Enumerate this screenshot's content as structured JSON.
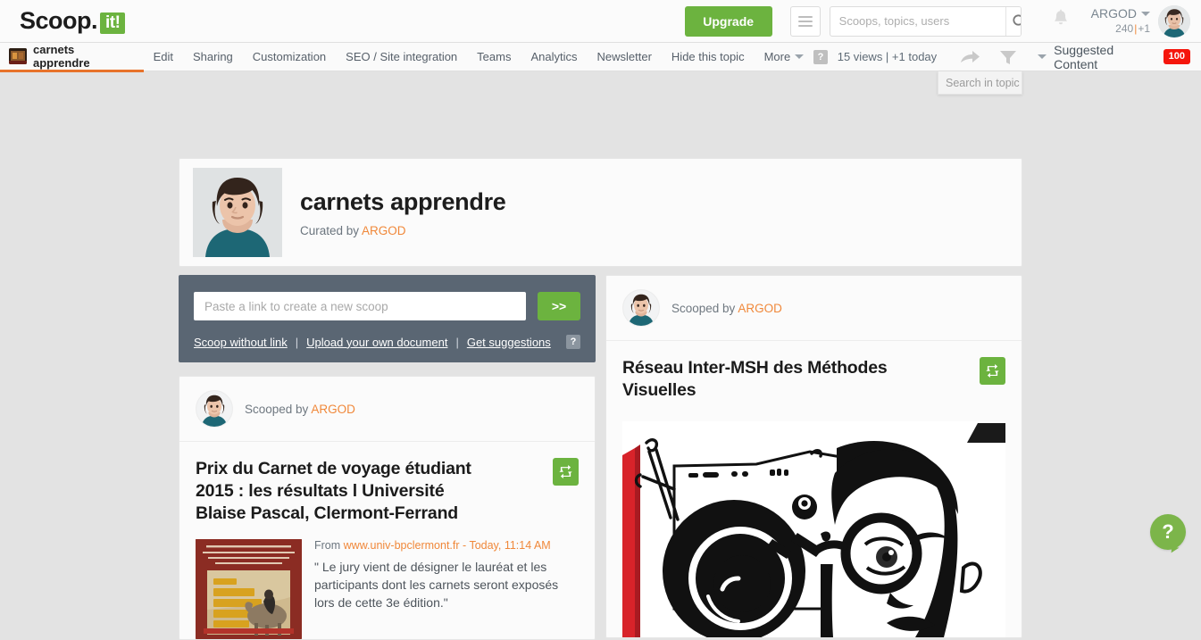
{
  "brand": {
    "name": "Scoop.",
    "suffix": "it!"
  },
  "topbar": {
    "upgrade_label": "Upgrade",
    "menu_icon": "hamburger-icon",
    "search_placeholder": "Scoops, topics, users",
    "search_value": "",
    "search_icon": "search-icon",
    "bell_icon": "bell-icon",
    "user_name": "ARGOD",
    "user_points": "240",
    "user_sep": "|",
    "user_delta": "+1",
    "avatar_icon": "user-avatar"
  },
  "subnav": {
    "topic_tab": "carnets apprendre",
    "items": [
      "Edit",
      "Sharing",
      "Customization",
      "SEO / Site integration",
      "Teams",
      "Analytics",
      "Newsletter",
      "Hide this topic",
      "More"
    ],
    "help_label": "?",
    "views": "15 views | +1 today",
    "share_icon": "share-arrow-icon",
    "filter_icon": "funnel-filter-icon",
    "suggested_label": "Suggested Content",
    "suggested_badge": "100",
    "search_in_topic_placeholder": "Search in topic"
  },
  "header": {
    "title": "carnets apprendre",
    "curated_prefix": "Curated by ",
    "curator": "ARGOD"
  },
  "scoop_box": {
    "input_placeholder": "Paste a link to create a new scoop",
    "input_value": "",
    "go_label": ">>",
    "link_without": "Scoop without link",
    "link_upload": "Upload your own document",
    "link_suggestions": "Get suggestions",
    "help_label": "?",
    "pipe": "|"
  },
  "posts": [
    {
      "scooped_prefix": "Scooped by ",
      "scooped_by": "ARGOD",
      "title": "Prix du Carnet de voyage étudiant 2015 : les résultats l Université Blaise Pascal, Clermont-Ferrand",
      "from_prefix": "From ",
      "source": "www.univ-bpclermont.fr",
      "date": "- Today, 11:14 AM",
      "excerpt": "\" Le jury vient de désigner le lauréat et les participants dont les carnets seront exposés lors de cette 3e édition.\"",
      "rescoop_icon": "rescoop-loop-icon",
      "thumb_icon": "poster-thumbnail"
    },
    {
      "scooped_prefix": "Scooped by ",
      "scooped_by": "ARGOD",
      "title": "Réseau Inter-MSH des Méthodes Visuelles",
      "rescoop_icon": "rescoop-loop-icon",
      "image_icon": "camera-portrait-illustration"
    }
  ],
  "help_bubble": {
    "label": "?",
    "icon": "help-chat-icon"
  },
  "colors": {
    "green": "#6cb33f",
    "orange": "#f0883a",
    "red_badge": "#f5160c",
    "tab_underline": "#e8732b",
    "scoop_box_bg": "#5a6673",
    "page_bg": "#e3e3e3"
  }
}
